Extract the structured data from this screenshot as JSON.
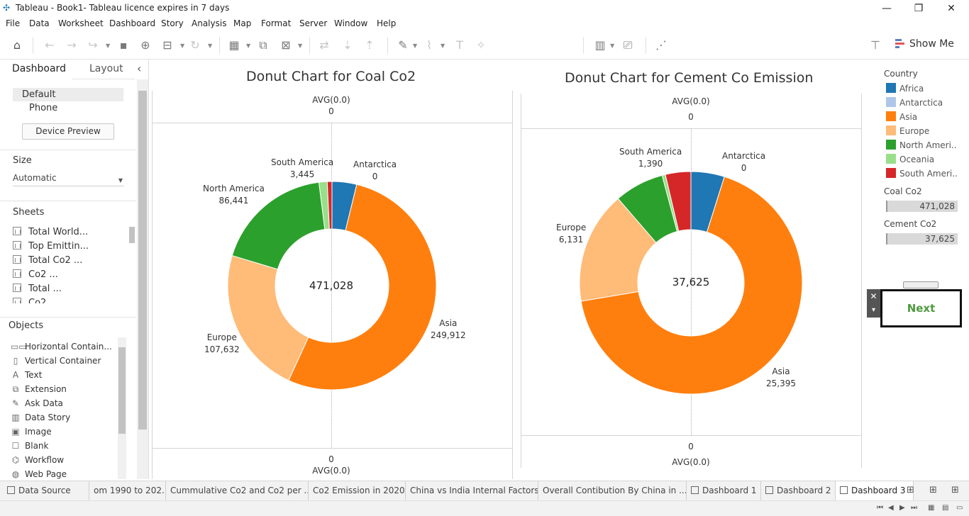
{
  "window": {
    "title": "Tableau - Book1- Tableau licence expires in 7 days",
    "minimize_glyph": "—",
    "restore_glyph": "❐",
    "close_glyph": "✕"
  },
  "menu": [
    "File",
    "Data",
    "Worksheet",
    "Dashboard",
    "Story",
    "Analysis",
    "Map",
    "Format",
    "Server",
    "Window",
    "Help"
  ],
  "toolbar": {
    "show_me_label": "Show Me"
  },
  "left_pane": {
    "tabs": [
      "Dashboard",
      "Layout"
    ],
    "collapse_glyph": "‹",
    "devices": [
      "Default",
      "Phone"
    ],
    "device_preview_label": "Device Preview",
    "size_title": "Size",
    "size_value": "Automatic",
    "sheets_title": "Sheets",
    "sheets": [
      "Total World...",
      "Top Emittin...",
      "Total Co2 ...",
      "Co2 ...",
      "Total ...",
      "Co2"
    ],
    "objects_title": "Objects",
    "objects": [
      {
        "label": "Horizontal Contain...",
        "icon": "horizontal-container-icon",
        "glyph": "▭▭"
      },
      {
        "label": "Vertical Container",
        "icon": "vertical-container-icon",
        "glyph": "▯"
      },
      {
        "label": "Text",
        "icon": "text-icon",
        "glyph": "A"
      },
      {
        "label": "Extension",
        "icon": "extension-icon",
        "glyph": "⧉"
      },
      {
        "label": "Ask Data",
        "icon": "ask-data-icon",
        "glyph": "✎"
      },
      {
        "label": "Data Story",
        "icon": "data-story-icon",
        "glyph": "▥"
      },
      {
        "label": "Image",
        "icon": "image-icon",
        "glyph": "▣"
      },
      {
        "label": "Blank",
        "icon": "blank-icon",
        "glyph": "☐"
      },
      {
        "label": "Workflow",
        "icon": "workflow-icon",
        "glyph": "⌬"
      },
      {
        "label": "Web Page",
        "icon": "web-page-icon",
        "glyph": "◍"
      }
    ]
  },
  "charts": {
    "left": {
      "title": "Donut Chart for Coal Co2",
      "avg_top_label": "AVG(0.0)",
      "avg_top_value": "0",
      "avg_bottom_value": "0",
      "avg_bottom_label": "AVG(0.0)",
      "center_total": "471,028"
    },
    "right": {
      "title": "Donut Chart for Cement Co Emission",
      "avg_top_label": "AVG(0.0)",
      "avg_top_value": "0",
      "avg_bottom_value": "0",
      "avg_bottom_label": "AVG(0.0)",
      "center_total": "37,625"
    }
  },
  "chart_data": [
    {
      "type": "pie",
      "title": "Donut Chart for Coal Co2",
      "center_label": "471,028",
      "slices": [
        {
          "name": "Antarctica",
          "value": 18000,
          "label_value": "0",
          "color": "#1f77b4"
        },
        {
          "name": "Asia",
          "value": 249912,
          "label_value": "249,912",
          "color": "#ff7f0e"
        },
        {
          "name": "Europe",
          "value": 107632,
          "label_value": "107,632",
          "color": "#ffbb78"
        },
        {
          "name": "North America",
          "value": 86441,
          "label_value": "86,441",
          "color": "#2ca02c"
        },
        {
          "name": "Oceania",
          "value": 6000,
          "label_value": "",
          "color": "#98df8a"
        },
        {
          "name": "South America",
          "value": 3445,
          "label_value": "3,445",
          "color": "#d62728"
        }
      ]
    },
    {
      "type": "pie",
      "title": "Donut Chart for Cement Co Emission",
      "center_label": "37,625",
      "slices": [
        {
          "name": "Antarctica",
          "value": 1830,
          "label_value": "0",
          "color": "#1f77b4"
        },
        {
          "name": "Asia",
          "value": 25395,
          "label_value": "25,395",
          "color": "#ff7f0e"
        },
        {
          "name": "Europe",
          "value": 6131,
          "label_value": "6,131",
          "color": "#ffbb78"
        },
        {
          "name": "North America",
          "value": 2700,
          "label_value": "",
          "color": "#2ca02c"
        },
        {
          "name": "Oceania",
          "value": 180,
          "label_value": "",
          "color": "#98df8a"
        },
        {
          "name": "South America",
          "value": 1390,
          "label_value": "1,390",
          "color": "#d62728"
        }
      ]
    }
  ],
  "legend": {
    "title": "Country",
    "items": [
      {
        "label": "Africa",
        "color": "#1f77b4"
      },
      {
        "label": "Antarctica",
        "color": "#aec7e8"
      },
      {
        "label": "Asia",
        "color": "#ff7f0e"
      },
      {
        "label": "Europe",
        "color": "#ffbb78"
      },
      {
        "label": "North Ameri..",
        "color": "#2ca02c"
      },
      {
        "label": "Oceania",
        "color": "#98df8a"
      },
      {
        "label": "South Ameri..",
        "color": "#d62728"
      }
    ]
  },
  "params": [
    {
      "title": "Coal Co2",
      "value": "471,028"
    },
    {
      "title": "Cement Co2",
      "value": "37,625"
    }
  ],
  "next_button": {
    "label": "Next",
    "close_glyph": "✕",
    "menu_glyph": "▾"
  },
  "bottom_tabs": [
    {
      "label": "Data Source",
      "kind": "datasource"
    },
    {
      "label": "om 1990 to 202...",
      "kind": "sheet"
    },
    {
      "label": "Cummulative Co2 and Co2 per ...",
      "kind": "sheet"
    },
    {
      "label": "Co2 Emission in 2020",
      "kind": "sheet"
    },
    {
      "label": "China vs India Internal Factors",
      "kind": "sheet"
    },
    {
      "label": "Overall Contibution By China in ...",
      "kind": "sheet"
    },
    {
      "label": "Dashboard 1",
      "kind": "dashboard"
    },
    {
      "label": "Dashboard 2",
      "kind": "dashboard"
    },
    {
      "label": "Dashboard 3",
      "kind": "dashboard",
      "active": true
    }
  ]
}
